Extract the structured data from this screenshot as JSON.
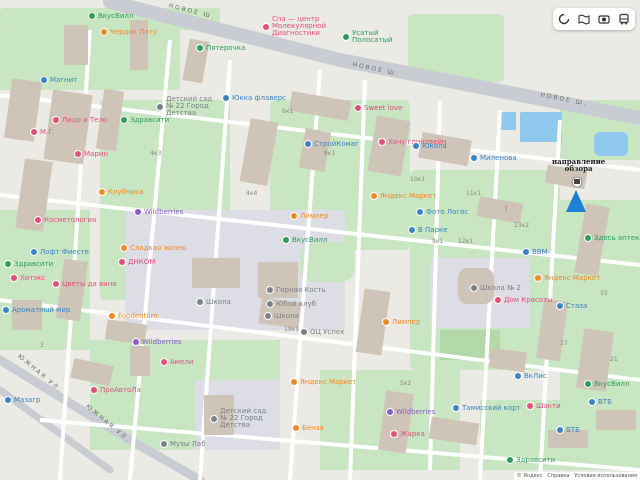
{
  "colors": {
    "land": "#eceae4",
    "block": "#dcdad2",
    "green": "#c8e6c2",
    "road": "#ffffff",
    "highway": "#c9ccd2",
    "water": "#8ec8ec",
    "building": "#cfc4b8",
    "poi_blue": "#3b83c4",
    "poi_green": "#2e9c5a",
    "poi_pink": "#e0517c",
    "poi_orange": "#ee8a24",
    "poi_purple": "#8b5cc7",
    "poi_gray": "#7b8188"
  },
  "streets": [
    {
      "id": "novoe-top",
      "label": "НОВОЕ Ш."
    },
    {
      "id": "novoe-mid",
      "label": "НОВОЕ Ш."
    },
    {
      "id": "novoe-right",
      "label": "НОВОЕ Ш."
    },
    {
      "id": "yuzhnaya-1",
      "label": "ЮЖНАЯ УЛ."
    },
    {
      "id": "yuzhnaya-2",
      "label": "ЮЖНАЯ УЛ."
    }
  ],
  "pois": [
    {
      "label": "ВкусВилл",
      "color": "poi_green",
      "icon": "cart-icon"
    },
    {
      "label": "Чердак Лату",
      "color": "poi_orange",
      "icon": "food-icon"
    },
    {
      "label": "Пятерочка",
      "color": "poi_green",
      "icon": "cart-icon"
    },
    {
      "label": "Магнит",
      "color": "poi_blue",
      "icon": "cart-icon"
    },
    {
      "label": "Лицо и Тело",
      "color": "poi_pink",
      "icon": "beauty-icon"
    },
    {
      "label": "М.Г.",
      "color": "poi_pink",
      "icon": "beauty-icon"
    },
    {
      "label": "Здравсити",
      "color": "poi_green",
      "icon": "pharmacy-icon"
    },
    {
      "label": "Марин",
      "color": "poi_pink",
      "icon": "beauty-icon"
    },
    {
      "label": "Юкка флаверс",
      "color": "poi_blue",
      "icon": "flower-icon"
    },
    {
      "label": "Sweet love",
      "color": "poi_pink",
      "icon": "beauty-icon"
    },
    {
      "label": "СтройКомаг",
      "color": "poi_blue",
      "icon": "shop-icon"
    },
    {
      "label": "Хочу глинтвейн",
      "color": "poi_pink",
      "icon": "cafe-icon"
    },
    {
      "label": "Яндекс Маркет",
      "color": "poi_orange",
      "icon": "shop-icon"
    },
    {
      "label": "Фото Логос",
      "color": "poi_blue",
      "icon": "shop-icon"
    },
    {
      "label": "Юкола",
      "color": "poi_blue",
      "icon": "shop-icon"
    },
    {
      "label": "Миленова",
      "color": "poi_blue",
      "icon": "shop-icon"
    },
    {
      "label": "Клубника",
      "color": "poi_orange",
      "icon": "food-icon"
    },
    {
      "label": "Косметология",
      "color": "poi_pink",
      "icon": "beauty-icon"
    },
    {
      "label": "Wildberries",
      "color": "poi_purple",
      "icon": "shop-icon"
    },
    {
      "label": "Лимпер",
      "color": "poi_orange",
      "icon": "food-icon"
    },
    {
      "label": "ВкусВилл",
      "color": "poi_green",
      "icon": "cart-icon"
    },
    {
      "label": "В Парке",
      "color": "poi_blue",
      "icon": "shop-icon"
    },
    {
      "label": "ВВМ",
      "color": "poi_blue",
      "icon": "shop-icon"
    },
    {
      "label": "Здесь аптека",
      "color": "poi_green",
      "icon": "pharmacy-icon"
    },
    {
      "label": "Лофт Фиесте",
      "color": "poi_blue",
      "icon": "shop-icon"
    },
    {
      "label": "Сладкая жизнь",
      "color": "poi_orange",
      "icon": "food-icon"
    },
    {
      "label": "Здравсити",
      "color": "poi_green",
      "icon": "pharmacy-icon"
    },
    {
      "label": "ДНКОМ",
      "color": "poi_pink",
      "icon": "lab-icon"
    },
    {
      "label": "Хитэкс",
      "color": "poi_pink",
      "icon": "shop-icon"
    },
    {
      "label": "Цветы да вина",
      "color": "poi_pink",
      "icon": "flower-icon"
    },
    {
      "label": "Ароматный мир",
      "color": "poi_blue",
      "icon": "cart-icon"
    },
    {
      "label": "Горная Кость",
      "color": "poi_gray",
      "icon": "sport-icon"
    },
    {
      "label": "Школа",
      "color": "poi_gray",
      "icon": "school-icon"
    },
    {
      "label": "Школа",
      "color": "poi_gray",
      "icon": "school-icon"
    },
    {
      "label": "Школа № 2",
      "color": "poi_gray",
      "icon": "school-icon"
    },
    {
      "label": "Яндекс Маркет",
      "color": "poi_orange",
      "icon": "shop-icon"
    },
    {
      "label": "Дом Красоты",
      "color": "poi_pink",
      "icon": "beauty-icon"
    },
    {
      "label": "Foodentum",
      "color": "poi_orange",
      "icon": "food-icon"
    },
    {
      "label": "Wildberries",
      "color": "poi_purple",
      "icon": "shop-icon"
    },
    {
      "label": "ОЦ Успех",
      "color": "poi_gray",
      "icon": "school-icon"
    },
    {
      "label": "Лимпер",
      "color": "poi_orange",
      "icon": "food-icon"
    },
    {
      "label": "Стаза",
      "color": "poi_blue",
      "icon": "shop-icon"
    },
    {
      "label": "Амели",
      "color": "poi_pink",
      "icon": "beauty-icon"
    },
    {
      "label": "ПроАвтоЛа",
      "color": "poi_pink",
      "icon": "car-icon"
    },
    {
      "label": "Яндекс Маркет",
      "color": "poi_orange",
      "icon": "shop-icon"
    },
    {
      "label": "ВкусВилл",
      "color": "poi_green",
      "icon": "cart-icon"
    },
    {
      "label": "ВкЛис",
      "color": "poi_blue",
      "icon": "shop-icon"
    },
    {
      "label": "Wildberries",
      "color": "poi_purple",
      "icon": "shop-icon"
    },
    {
      "label": "Тамисский корт",
      "color": "poi_blue",
      "icon": "sport-icon"
    },
    {
      "label": "Шакти",
      "color": "poi_pink",
      "icon": "beauty-icon"
    },
    {
      "label": "ВТБ",
      "color": "poi_blue",
      "icon": "bank-icon"
    },
    {
      "label": "Жарка",
      "color": "poi_pink",
      "icon": "food-icon"
    },
    {
      "label": "Музы Лаб",
      "color": "poi_gray",
      "icon": "school-icon"
    },
    {
      "label": "ВТБ",
      "color": "poi_blue",
      "icon": "bank-icon"
    },
    {
      "label": "Здравсити",
      "color": "poi_green",
      "icon": "pharmacy-icon"
    },
    {
      "label": "Бенза",
      "color": "poi_orange",
      "icon": "food-icon"
    },
    {
      "label": "Детский сад № 22 Город Детства",
      "color": "poi_gray",
      "icon": "kindergarten-icon"
    },
    {
      "label": "Детский сад № 22 Город Детства",
      "color": "poi_gray",
      "icon": "kindergarten-icon"
    },
    {
      "label": "Усатый Полосатый",
      "color": "poi_green",
      "icon": "pet-icon"
    },
    {
      "label": "Спа — центр Молекулярной Диагностики",
      "color": "poi_pink",
      "icon": "clinic-icon"
    },
    {
      "label": "Юбой клуб",
      "color": "poi_gray",
      "icon": "sport-icon"
    },
    {
      "label": "Мазагр",
      "color": "poi_blue",
      "icon": "cart-icon"
    }
  ],
  "house_numbers": [
    "4к3",
    "4к4",
    "6к1",
    "8к1",
    "10к1",
    "11к1",
    "7",
    "9к1",
    "12к1",
    "13к2",
    "15",
    "3",
    "5к2",
    "17",
    "19к1",
    "21"
  ],
  "annotation": {
    "line1": "направление",
    "line2": "обзора"
  },
  "toolbar": [
    {
      "id": "layers",
      "icon": "layers-icon"
    },
    {
      "id": "panorama",
      "icon": "panorama-icon"
    },
    {
      "id": "camera",
      "icon": "camera-icon"
    },
    {
      "id": "transport",
      "icon": "bus-icon"
    }
  ],
  "copyright": {
    "brand": "© Яндекс",
    "help": "Справка",
    "terms": "Условия использования"
  }
}
